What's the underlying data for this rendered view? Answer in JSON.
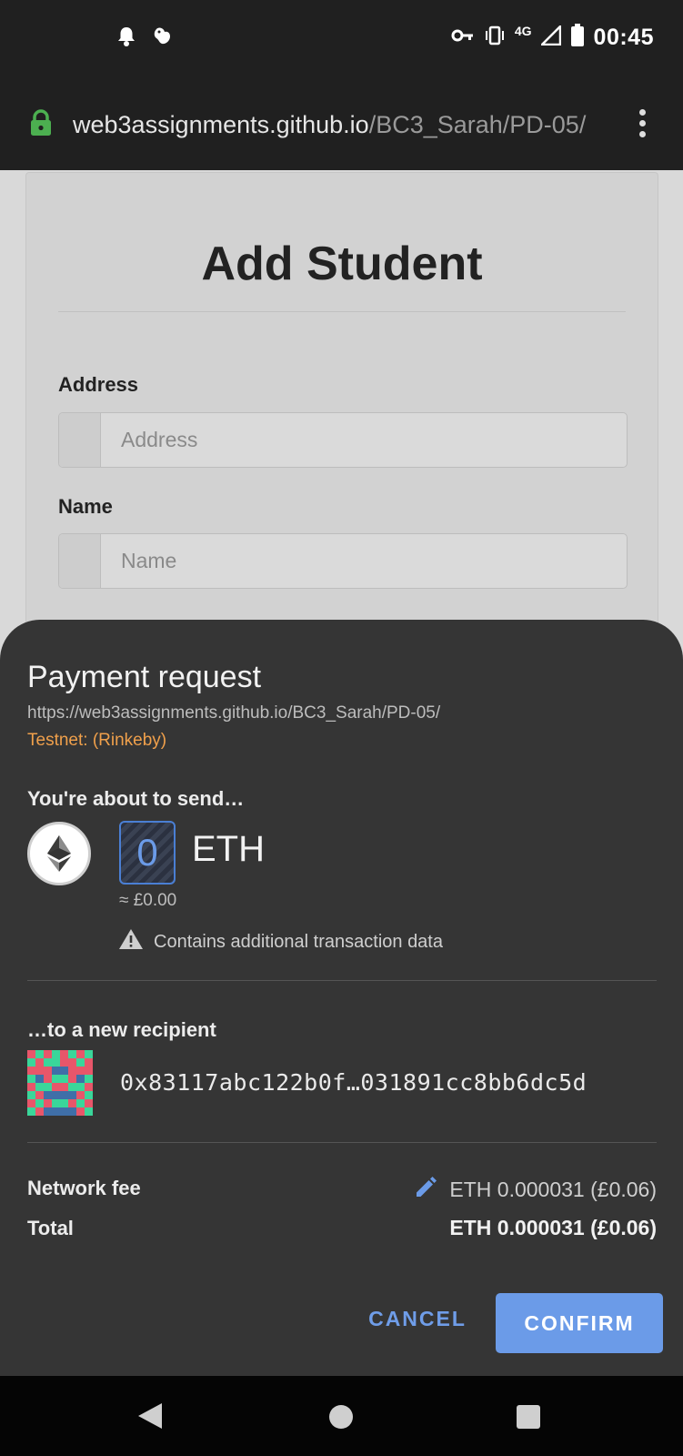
{
  "status_bar": {
    "time": "00:45",
    "network": "4G",
    "icons": [
      "notification-bell-icon",
      "rodent-notification-icon",
      "vpn-key-icon",
      "vibrate-icon",
      "signal-icon",
      "battery-icon"
    ]
  },
  "browser": {
    "url_host": "web3assignments.github.io",
    "url_path": "/BC3_Sarah/PD-05/",
    "secure": true
  },
  "page": {
    "title": "Add Student",
    "fields": [
      {
        "label": "Address",
        "placeholder": "Address",
        "value": ""
      },
      {
        "label": "Name",
        "placeholder": "Name",
        "value": ""
      }
    ]
  },
  "payment_sheet": {
    "title": "Payment request",
    "origin": "https://web3assignments.github.io/BC3_Sarah/PD-05/",
    "network": "Testnet: (Rinkeby)",
    "about_to_send": "You're about to send…",
    "amount": "0",
    "currency": "ETH",
    "fiat_estimate": "≈ £0.00",
    "warning": "Contains additional transaction data",
    "to_label": "…to a new recipient",
    "recipient": "0x83117abc122b0f…031891cc8bb6dc5d",
    "network_fee_label": "Network fee",
    "network_fee": "ETH 0.000031 (£0.06)",
    "total_label": "Total",
    "total": "ETH 0.000031 (£0.06)",
    "cancel_label": "CANCEL",
    "confirm_label": "CONFIRM"
  },
  "colors": {
    "accent": "#6b9be8",
    "testnet": "#f0a04b",
    "sheet_bg": "#353535",
    "identicon": [
      "#e8566a",
      "#3ad69a",
      "#3f6fa8"
    ]
  },
  "identicon_pattern": [
    "01010101",
    "10110010",
    "00022000",
    "12011021",
    "01100110",
    "10222201",
    "01011010",
    "10222201"
  ]
}
